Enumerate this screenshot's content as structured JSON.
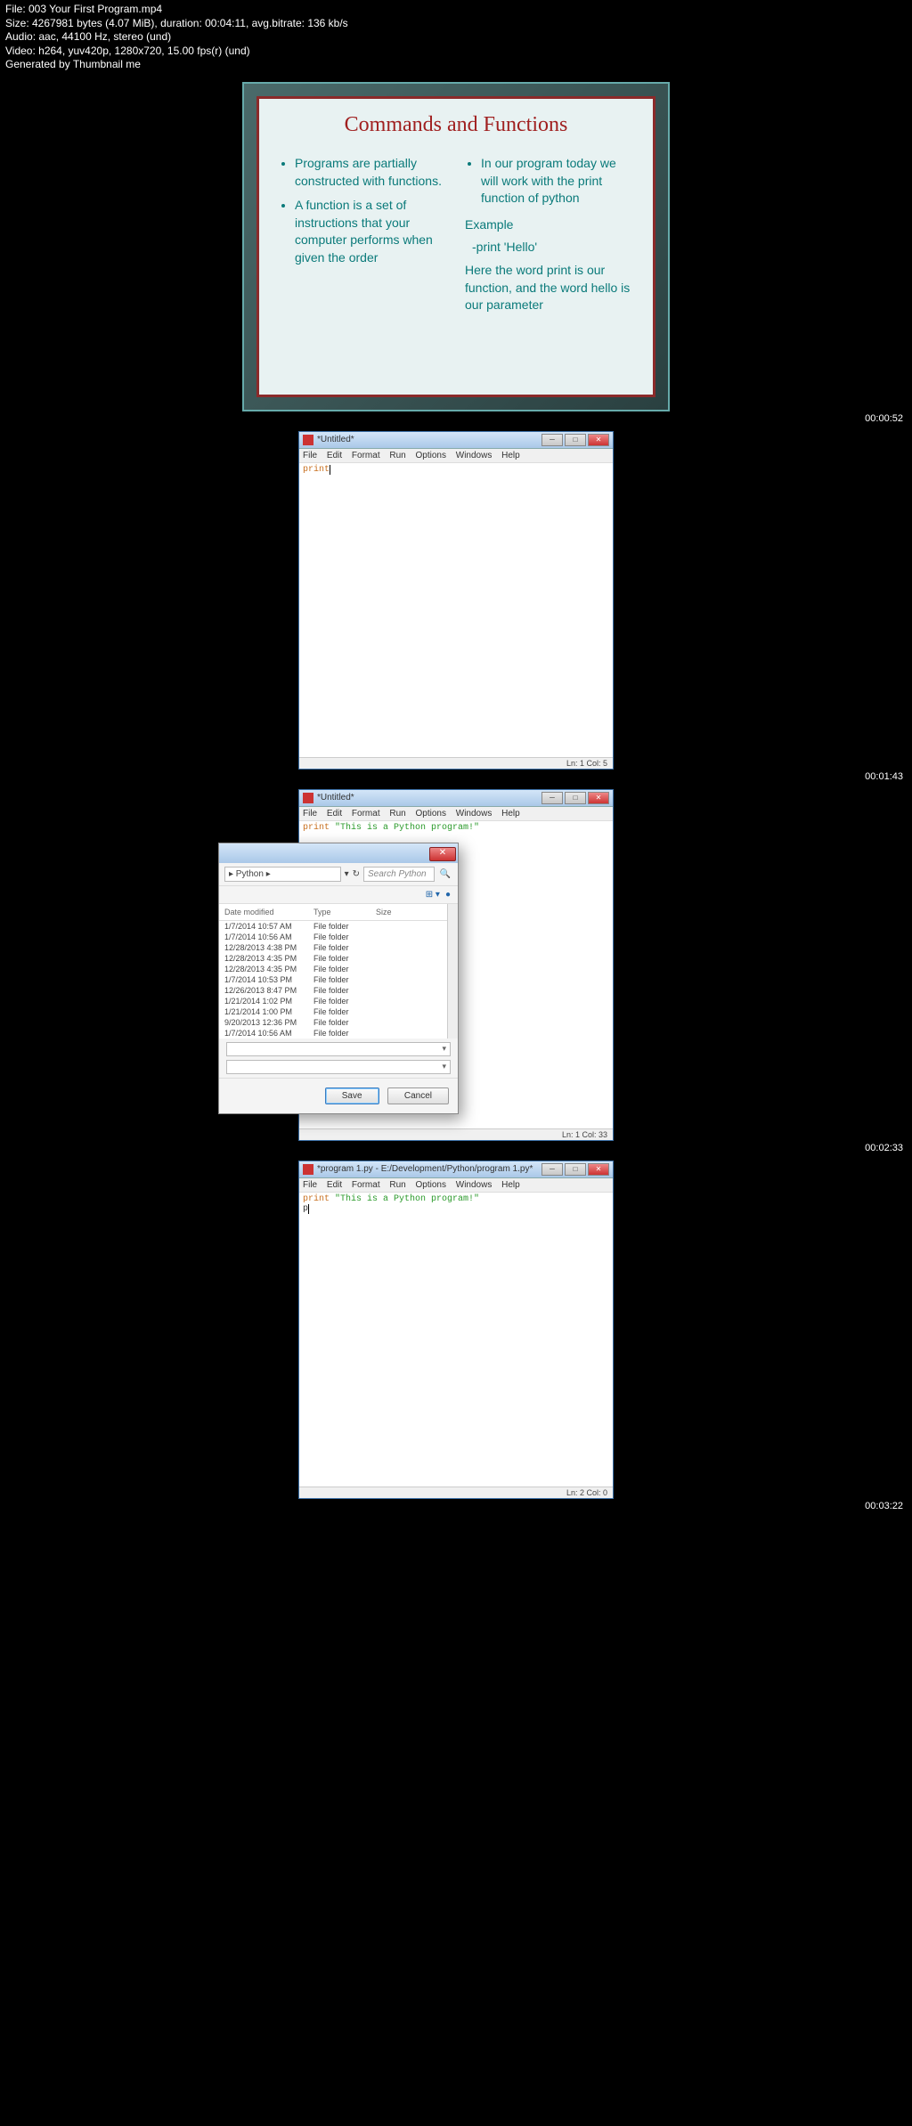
{
  "header": {
    "file": "File: 003 Your First Program.mp4",
    "size": "Size: 4267981 bytes (4.07 MiB), duration: 00:04:11, avg.bitrate: 136 kb/s",
    "audio": "Audio: aac, 44100 Hz, stereo (und)",
    "video": "Video: h264, yuv420p, 1280x720, 15.00 fps(r) (und)",
    "gen": "Generated by Thumbnail me"
  },
  "slide": {
    "title": "Commands and Functions",
    "left_1": "Programs are partially constructed with functions.",
    "left_2": "A function is a set of instructions that your computer performs when given the order",
    "right_1": "In our program today we will work with the print function of python",
    "example_label": "Example",
    "example_code": "-print 'Hello'",
    "right_2": "Here the word print is our function, and the word hello is our parameter"
  },
  "ts": {
    "t1": "00:00:52",
    "t2": "00:01:43",
    "t3": "00:02:33",
    "t4": "00:03:22"
  },
  "menu": {
    "file": "File",
    "edit": "Edit",
    "format": "Format",
    "run": "Run",
    "options": "Options",
    "windows": "Windows",
    "help": "Help"
  },
  "win1": {
    "title": "*Untitled*",
    "code": "print",
    "status": "Ln: 1 Col: 5"
  },
  "win2": {
    "title": "*Untitled*",
    "code_kw": "print ",
    "code_str": "\"This is a Python program!\"",
    "status": "Ln: 1 Col: 33"
  },
  "win3": {
    "title": "*program 1.py - E:/Development/Python/program 1.py*",
    "code_kw": "print ",
    "code_str": "\"This is a Python program!\"",
    "code_line2": "p",
    "status": "Ln: 2 Col: 0"
  },
  "dialog": {
    "path": "▸ Python ▸",
    "search": "Search Python",
    "col_date": "Date modified",
    "col_type": "Type",
    "col_size": "Size",
    "type_val": "File folder",
    "rows": [
      "1/7/2014 10:57 AM",
      "1/7/2014 10:56 AM",
      "12/28/2013 4:38 PM",
      "12/28/2013 4:35 PM",
      "12/28/2013 4:35 PM",
      "1/7/2014 10:53 PM",
      "12/26/2013 8:47 PM",
      "1/21/2014 1:02 PM",
      "1/21/2014 1:00 PM",
      "9/20/2013 12:36 PM",
      "1/7/2014 10:56 AM"
    ],
    "save": "Save",
    "cancel": "Cancel"
  }
}
